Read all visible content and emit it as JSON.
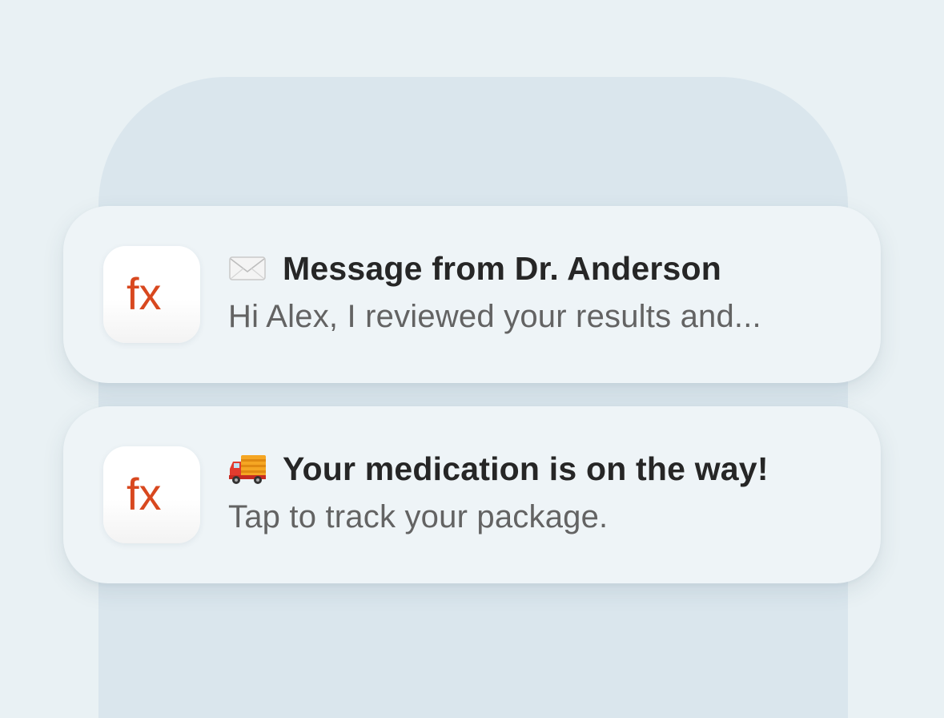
{
  "notifications": [
    {
      "app_icon_text": "fx",
      "emoji": "envelope-icon",
      "title": "Message from Dr. Anderson",
      "body": "Hi Alex, I reviewed your results and..."
    },
    {
      "app_icon_text": "fx",
      "emoji": "delivery-truck-icon",
      "title": "Your medication is on the way!",
      "body": "Tap to track your package."
    }
  ],
  "colors": {
    "background": "#e9f1f4",
    "phone_backdrop": "#dae6ed",
    "card": "#eef4f7",
    "brand_logo": "#d8481f",
    "title_text": "#262626",
    "body_text": "#636363"
  }
}
